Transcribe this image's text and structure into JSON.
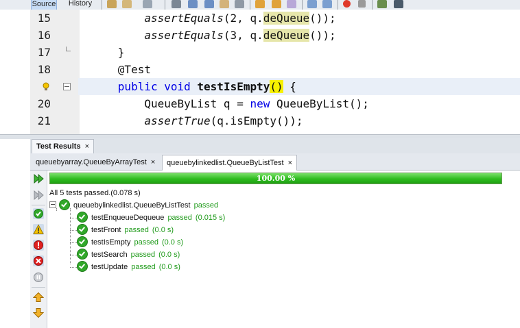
{
  "toolbar": {
    "source_tab": "Source",
    "history_tab": "History"
  },
  "editor": {
    "lines": [
      {
        "num": "15",
        "indent": "          ",
        "call": "assertEquals",
        "args_a": "(2, q.",
        "method": "deQueue",
        "args_b": "());"
      },
      {
        "num": "16",
        "indent": "          ",
        "call": "assertEquals",
        "args_a": "(3, q.",
        "method": "deQueue",
        "args_b": "());"
      },
      {
        "num": "17",
        "text": "      }"
      },
      {
        "num": "18",
        "text": "      @Test"
      },
      {
        "num": "",
        "kw1": "public",
        "kw2": "void",
        "name": "testIsEmpty",
        "parens": "()",
        "tail": " {"
      },
      {
        "num": "20",
        "type": "QueueByList",
        "var": " q = ",
        "kw": "new",
        "ctor": " QueueByList();"
      },
      {
        "num": "21",
        "call": "assertTrue",
        "args": "(q.isEmpty());"
      }
    ]
  },
  "panel": {
    "title": "Test Results",
    "close": "×"
  },
  "subtabs": [
    {
      "label": "queuebyarray.QueueByArrayTest",
      "close": "×"
    },
    {
      "label": "queuebylinkedlist.QueueByListTest",
      "close": "×"
    }
  ],
  "progress": {
    "value": 1.0,
    "label": "100.00 %"
  },
  "summary": "All 5 tests passed.(0.078 s)",
  "suite": {
    "name": "queuebylinkedlist.QueueByListTest",
    "status": "passed"
  },
  "tests": [
    {
      "name": "testEnqueueDequeue",
      "status": "passed",
      "time": "(0.015 s)"
    },
    {
      "name": "testFront",
      "status": "passed",
      "time": "(0.0 s)"
    },
    {
      "name": "testIsEmpty",
      "status": "passed",
      "time": "(0.0 s)"
    },
    {
      "name": "testSearch",
      "status": "passed",
      "time": "(0.0 s)"
    },
    {
      "name": "testUpdate",
      "status": "passed",
      "time": "(0.0 s)"
    }
  ],
  "colors": {
    "pass_green": "#1f9a1a",
    "keyword_blue": "#0000e6",
    "occurrence": "#e6e6aa",
    "brace_match": "#f7f000"
  },
  "side_icons": [
    "rerun-icon",
    "rerun-failed-icon",
    "show-passed-icon",
    "show-warnings-icon",
    "show-failures-icon",
    "show-errors-icon",
    "show-aborted-icon",
    "previous-failure-icon",
    "next-failure-icon"
  ]
}
